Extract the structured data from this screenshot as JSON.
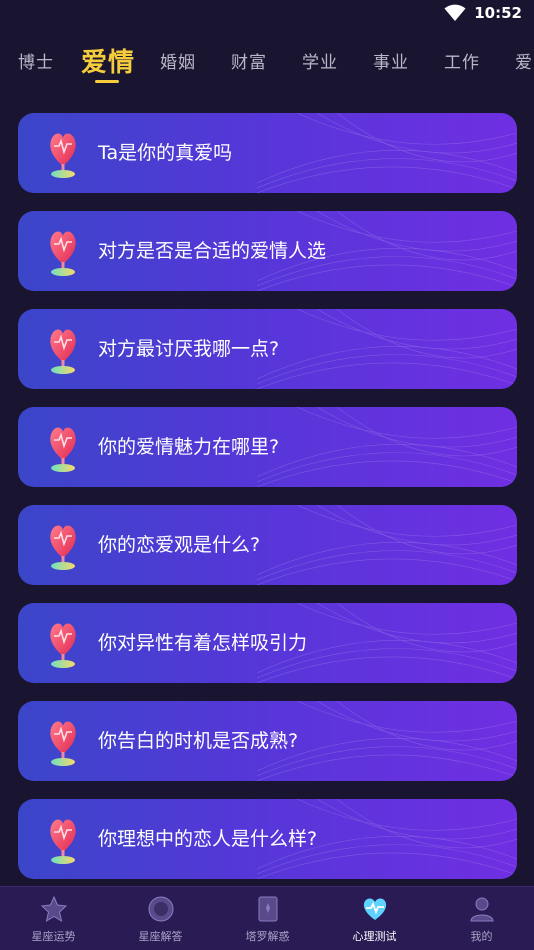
{
  "status_bar": {
    "time": "10:52"
  },
  "tabs": [
    {
      "label": "博士"
    },
    {
      "label": "爱情",
      "active": true
    },
    {
      "label": "婚姻"
    },
    {
      "label": "财富"
    },
    {
      "label": "学业"
    },
    {
      "label": "事业"
    },
    {
      "label": "工作"
    },
    {
      "label": "爱"
    }
  ],
  "cards": [
    {
      "title": "Ta是你的真爱吗"
    },
    {
      "title": "对方是否是合适的爱情人选"
    },
    {
      "title": "对方最讨厌我哪一点?"
    },
    {
      "title": "你的爱情魅力在哪里?"
    },
    {
      "title": "你的恋爱观是什么?"
    },
    {
      "title": "你对异性有着怎样吸引力"
    },
    {
      "title": "你告白的时机是否成熟?"
    },
    {
      "title": "你理想中的恋人是什么样?"
    }
  ],
  "bottom_nav": [
    {
      "label": "星座运势",
      "icon": "star-icon"
    },
    {
      "label": "星座解答",
      "icon": "orb-icon"
    },
    {
      "label": "塔罗解惑",
      "icon": "tarot-card-icon"
    },
    {
      "label": "心理测试",
      "icon": "heart-pulse-icon",
      "active": true
    },
    {
      "label": "我的",
      "icon": "user-icon"
    }
  ],
  "colors": {
    "background": "#191530",
    "accent": "#f5cd3c",
    "card_start": "#3b46c9",
    "card_end": "#6f2fe2",
    "nav_bg": "#2a1b54"
  }
}
